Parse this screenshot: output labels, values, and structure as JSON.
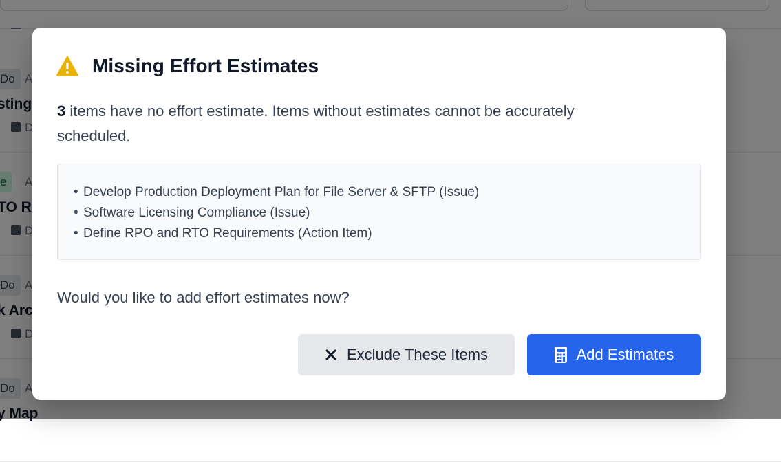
{
  "background": {
    "cards": [
      {
        "badge": "Do",
        "assignee": "A",
        "title": "sting",
        "date": "D"
      },
      {
        "badge": "e",
        "assignee": "A",
        "title": "TO Re",
        "date": "D"
      },
      {
        "badge": "Do",
        "assignee": "A",
        "title": "k Arc",
        "date": "D"
      },
      {
        "badge": "Do",
        "assignee": "A",
        "title": "y Map",
        "date": ""
      }
    ]
  },
  "modal": {
    "title": "Missing Effort Estimates",
    "warning_icon": "warning-triangle-icon",
    "count": "3",
    "description": " items have no effort estimate. Items without estimates cannot be accurately scheduled.",
    "bullet": "•",
    "items": [
      "Develop Production Deployment Plan for File Server & SFTP (Issue)",
      "Software Licensing Compliance (Issue)",
      "Define RPO and RTO Requirements (Action Item)"
    ],
    "question": "Would you like to add effort estimates now?",
    "exclude_button": {
      "label": "Exclude These Items",
      "icon": "close-icon"
    },
    "add_button": {
      "label": "Add Estimates",
      "icon": "calculator-icon"
    }
  },
  "colors": {
    "primary": "#2563eb",
    "warning": "#eab308",
    "secondary_button": "#e5e7eb"
  }
}
